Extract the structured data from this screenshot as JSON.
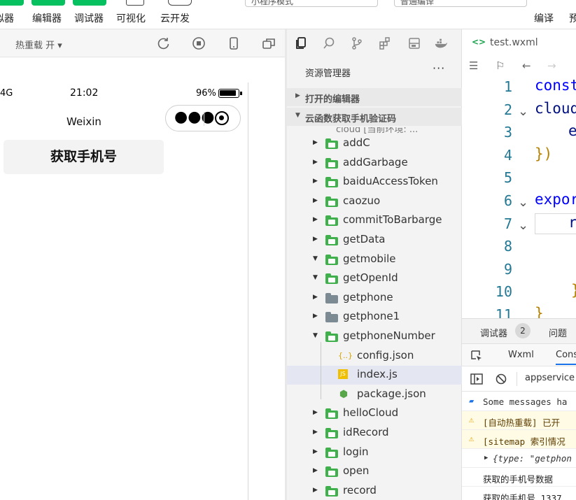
{
  "toolbar": {
    "buttons": [
      {
        "label": "拟器"
      },
      {
        "label": "编辑器"
      },
      {
        "label": "调试器"
      }
    ],
    "visualize": "可视化",
    "cloud_dev": "云开发",
    "mode_select": "小程序模式",
    "compile_select": "普通编译",
    "compile": "编译",
    "preview": "预"
  },
  "simulator": {
    "hot_reload": "热重载 开",
    "network": "4G",
    "time": "21:02",
    "battery": "96%",
    "nav_title": "Weixin",
    "button_label": "获取手机号"
  },
  "explorer": {
    "title": "资源管理器",
    "more": "···",
    "open_editors": "打开的编辑器",
    "project": "云函数获取手机验证码",
    "cut_label": "cloud [当前环境: ...",
    "items": [
      {
        "name": "addC",
        "type": "folder",
        "expanded": false
      },
      {
        "name": "addGarbage",
        "type": "folder",
        "expanded": false
      },
      {
        "name": "baiduAccessToken",
        "type": "folder",
        "expanded": false
      },
      {
        "name": "caozuo",
        "type": "folder",
        "expanded": false
      },
      {
        "name": "commitToBarbarge",
        "type": "folder",
        "expanded": false
      },
      {
        "name": "getData",
        "type": "folder",
        "expanded": false
      },
      {
        "name": "getmobile",
        "type": "folder",
        "expanded": true
      },
      {
        "name": "getOpenId",
        "type": "folder",
        "expanded": true
      },
      {
        "name": "getphone",
        "type": "folder-gray",
        "expanded": false
      },
      {
        "name": "getphone1",
        "type": "folder-gray",
        "expanded": false
      },
      {
        "name": "getphoneNumber",
        "type": "folder",
        "expanded": true
      },
      {
        "name": "config.json",
        "type": "json",
        "icon": "{..}"
      },
      {
        "name": "index.js",
        "type": "js",
        "icon": "JS",
        "selected": true
      },
      {
        "name": "package.json",
        "type": "pkg",
        "icon": "⬢"
      },
      {
        "name": "helloCloud",
        "type": "folder",
        "expanded": false
      },
      {
        "name": "idRecord",
        "type": "folder",
        "expanded": false
      },
      {
        "name": "login",
        "type": "folder",
        "expanded": false
      },
      {
        "name": "open",
        "type": "folder",
        "expanded": false
      },
      {
        "name": "record",
        "type": "folder",
        "expanded": false
      }
    ]
  },
  "editor": {
    "tab_name": "test.wxml",
    "tab_icon": "<>",
    "lines": [
      {
        "n": "1",
        "code": "const"
      },
      {
        "n": "2",
        "code": "cloud"
      },
      {
        "n": "3",
        "code": "e"
      },
      {
        "n": "4",
        "code": "})"
      },
      {
        "n": "5",
        "code": ""
      },
      {
        "n": "6",
        "code": "expor"
      },
      {
        "n": "7",
        "code": "r"
      },
      {
        "n": "8",
        "code": ""
      },
      {
        "n": "9",
        "code": ""
      },
      {
        "n": "10",
        "code": "}"
      },
      {
        "n": "11",
        "code": "}"
      }
    ]
  },
  "debugger": {
    "tab_debugger": "调试器",
    "badge": "2",
    "tab_issues": "问题",
    "sub_wxml": "Wxml",
    "sub_console": "Cons",
    "context": "appservice",
    "messages": [
      {
        "level": "info",
        "text": "Some messages ha"
      },
      {
        "level": "warn",
        "text": "[自动热重载] 已开"
      },
      {
        "level": "warn",
        "text": "[sitemap 索引情况"
      },
      {
        "level": "obj",
        "text": "{type: \"getphon"
      },
      {
        "level": "log",
        "text": "获取的手机号数据"
      },
      {
        "level": "log",
        "text": "获取的手机号 1337"
      }
    ]
  },
  "colors": {
    "accent_green": "#07c160",
    "folder_green": "#3fb04c",
    "folder_gray": "#7c8a93",
    "selection": "#e4e6f1",
    "code_keyword": "#0000ff",
    "line_number": "#237893"
  }
}
